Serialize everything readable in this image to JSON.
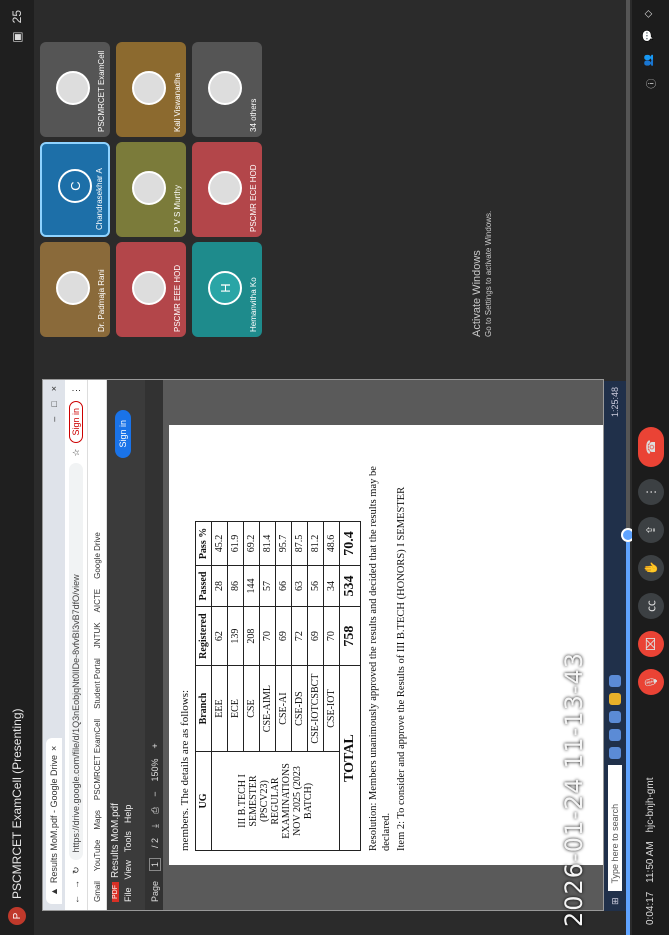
{
  "meeting": {
    "title": "PSCMRCET ExamCell (Presenting)",
    "participant_count_badge": "25",
    "clock": "11:50 AM",
    "meeting_code": "hjc-bnjh-gmt",
    "elapsed": "0:04:17",
    "progress_fraction": 0.42
  },
  "browser": {
    "tab_title": "Results MoM.pdf - Google Drive",
    "url": "https://drive.google.com/file/d/1Q3nEobjqNt0lIDe-8vfvBI3vB7dfO/view",
    "signin_label": "Sign in",
    "bookmarks": [
      "Gmail",
      "YouTube",
      "Maps",
      "PSCMRCET ExamCell",
      "Student Portal",
      "JNTUK",
      "AICTE",
      "Google Drive"
    ]
  },
  "pdf": {
    "filename": "Results MoM.pdf",
    "menu": [
      "File",
      "View",
      "Tools",
      "Help"
    ],
    "page_label": "Page",
    "page_current": "1",
    "page_total": "/ 2",
    "zoom": "150%",
    "sign_in_label": "Sign in",
    "intro": "members. The details are as follows:",
    "table": {
      "headers": [
        "UG",
        "Branch",
        "Registered",
        "Passed",
        "Pass %"
      ],
      "ug_label": "III B.TECH I SEMESTER (PSCV23) REGULAR EXAMINATIONS NOV 2025 (2023 BATCH)",
      "rows": [
        [
          "EEE",
          "62",
          "28",
          "45.2"
        ],
        [
          "ECE",
          "139",
          "86",
          "61.9"
        ],
        [
          "CSE",
          "208",
          "144",
          "69.2"
        ],
        [
          "CSE-AIML",
          "70",
          "57",
          "81.4"
        ],
        [
          "CSE-AI",
          "69",
          "66",
          "95.7"
        ],
        [
          "CSE-DS",
          "72",
          "63",
          "87.5"
        ],
        [
          "CSE-IOTCSBCT",
          "69",
          "56",
          "81.2"
        ],
        [
          "CSE-IOT",
          "70",
          "34",
          "48.6"
        ]
      ],
      "total": [
        "TOTAL",
        "758",
        "534",
        "70.4"
      ]
    },
    "resolution": "Resolution: Members unanimously approved the results and decided that the results may be declared.",
    "item": "Item 2: To consider and approve the Results of III B.TECH (HONORS) I SEMESTER"
  },
  "timestamp": "2026-01-24 11-13-43",
  "participants": [
    {
      "name": "Dr. Padmaja Rani",
      "color": "brown"
    },
    {
      "name": "PSCMR EEE HOD",
      "color": "red"
    },
    {
      "name": "Chandrasekhar A",
      "color": "blue",
      "initial": "C"
    },
    {
      "name": "P V S Murthy",
      "color": "olive"
    },
    {
      "name": "PSCMR ECE HOD",
      "color": "red"
    },
    {
      "name": "PSCMRCET ExamCell",
      "color": "grey"
    },
    {
      "name": "Kali Viswanadha",
      "color": "olive2"
    },
    {
      "name": "34 others",
      "color": "grey"
    },
    {
      "name": "Hemanvitha Ko",
      "color": "teal",
      "initial": "H"
    }
  ],
  "activate_windows": {
    "line1": "Activate Windows",
    "line2": "Go to Settings to activate Windows."
  },
  "taskbar": {
    "search_placeholder": "Type here to search",
    "clock": "1:25:48"
  }
}
